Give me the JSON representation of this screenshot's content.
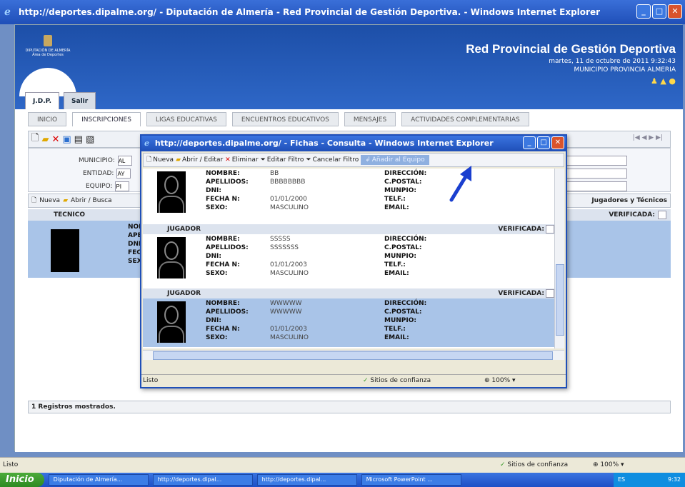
{
  "window": {
    "title": "http://deportes.dipalme.org/ - Diputación de Almería - Red Provincial de Gestión Deportiva. - Windows Internet Explorer"
  },
  "header": {
    "logo_text": "DIPUTACIÓN DE ALMERÍA",
    "logo_sub": "Área de Deportes",
    "title": "Red Provincial de Gestión Deportiva",
    "date": "martes, 11 de octubre de 2011 9:32:43",
    "municipio": "MUNICIPIO PROVINCIA ALMERIA"
  },
  "top_tabs": [
    {
      "label": "J.D.P."
    },
    {
      "label": "Salir"
    }
  ],
  "nav_tabs": [
    {
      "label": "INICIO"
    },
    {
      "label": "INSCRIPCIONES"
    },
    {
      "label": "LIGAS EDUCATIVAS"
    },
    {
      "label": "ENCUENTROS EDUCATIVOS"
    },
    {
      "label": "MENSAJES"
    },
    {
      "label": "ACTIVIDADES COMPLEMENTARIAS"
    }
  ],
  "form": {
    "municipio_label": "MUNICIPIO:",
    "municipio_value": "AL",
    "entidad_label": "ENTIDAD:",
    "entidad_value": "AY",
    "equipo_label": "EQUIPO:",
    "equipo_value": "PI"
  },
  "list_toolbar": {
    "nueva": "Nueva",
    "abrir": "Abrir / Busca",
    "right_title": "Jugadores y Técnicos"
  },
  "list_header": {
    "col": "TECNICO",
    "verificada": "VERIFICADA:"
  },
  "tecnico_labels": [
    "NOM",
    "APE",
    "DNI",
    "FECH",
    "SEXO"
  ],
  "footer": {
    "registros": "1 Registros mostrados."
  },
  "popup": {
    "title": "http://deportes.dipalme.org/ - Fichas - Consulta - Windows Internet Explorer",
    "toolbar": {
      "nueva": "Nueva",
      "abrir": "Abrir / Editar",
      "eliminar": "Eliminar",
      "editar_filtro": "Editar Filtro",
      "cancelar_filtro": "Cancelar Filtro",
      "anadir": "Añadir al Equipo"
    },
    "labels": {
      "nombre": "NOMBRE:",
      "apellidos": "APELLIDOS:",
      "dni": "DNI:",
      "fecha": "FECHA N:",
      "sexo": "SEXO:",
      "direccion": "DIRECCIÓN:",
      "cpostal": "C.POSTAL:",
      "munpio": "MUNPIO:",
      "telf": "TELF.:",
      "email": "EMAIL:",
      "jugador": "JUGADOR",
      "verificada": "VERIFICADA:"
    },
    "records": [
      {
        "nombre": "BB",
        "apellidos": "BBBBBBBB",
        "fecha": "01/01/2000",
        "sexo": "MASCULINO"
      },
      {
        "nombre": "SSSSS",
        "apellidos": "SSSSSSS",
        "fecha": "01/01/2003",
        "sexo": "MASCULINO"
      },
      {
        "nombre": "WWWWW",
        "apellidos": "WWWWW",
        "fecha": "01/01/2003",
        "sexo": "MASCULINO"
      }
    ],
    "status": {
      "left": "Listo",
      "trust": "Sitios de confianza",
      "zoom": "100%"
    }
  },
  "statusbar": {
    "left": "Listo",
    "trust": "Sitios de confianza",
    "zoom": "100%"
  },
  "taskbar": {
    "start": "Inicio",
    "tasks": [
      "Diputación de Almería...",
      "http://deportes.dipal...",
      "http://deportes.dipal...",
      "Microsoft PowerPoint ..."
    ],
    "tray": "ES",
    "clock": "9:32"
  },
  "colors": {
    "accent": "#1f4fb8",
    "selected_row": "#a9c4e8",
    "arrow": "#1a3fcf"
  }
}
